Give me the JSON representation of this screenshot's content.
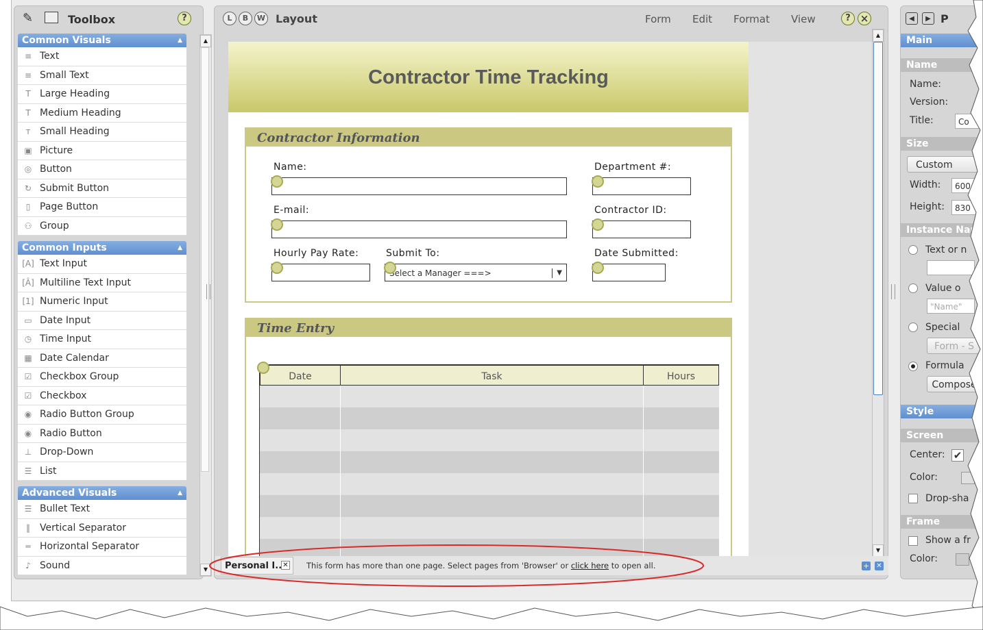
{
  "toolbox": {
    "title": "Toolbox",
    "help": "?",
    "categories": [
      {
        "label": "Common Visuals",
        "items": [
          "Text",
          "Small Text",
          "Large Heading",
          "Medium Heading",
          "Small Heading",
          "Picture",
          "Button",
          "Submit Button",
          "Page Button",
          "Group"
        ]
      },
      {
        "label": "Common Inputs",
        "items": [
          "Text Input",
          "Multiline Text Input",
          "Numeric Input",
          "Date Input",
          "Time Input",
          "Date Calendar",
          "Checkbox Group",
          "Checkbox",
          "Radio Button Group",
          "Radio Button",
          "Drop-Down",
          "List"
        ]
      },
      {
        "label": "Advanced Visuals",
        "items": [
          "Bullet Text",
          "Vertical Separator",
          "Horizontal Separator",
          "Sound"
        ]
      }
    ]
  },
  "layout": {
    "view_buttons": [
      "L",
      "B",
      "W"
    ],
    "title": "Layout",
    "menu": [
      "Form",
      "Edit",
      "Format",
      "View"
    ],
    "help": "?",
    "close": "×"
  },
  "form": {
    "title": "Contractor Time Tracking",
    "contractor_section": "Contractor Information",
    "labels": {
      "name": "Name:",
      "department": "Department #:",
      "email": "E-mail:",
      "contractor_id": "Contractor ID:",
      "hourly_rate": "Hourly Pay Rate:",
      "submit_to": "Submit To:",
      "date_submitted": "Date Submitted:"
    },
    "submit_to_value": "Select a Manager ===>",
    "time_section": "Time Entry",
    "table_headers": [
      "Date",
      "Task",
      "Hours"
    ]
  },
  "status_bar": {
    "page_tab": "Personal I...",
    "message_before": "This form has more than one page. Select pages from 'Browser' or ",
    "link": "click here",
    "message_after": " to open all."
  },
  "properties": {
    "title": "P",
    "main": "Main",
    "name_section": "Name",
    "name_label": "Name:",
    "version_label": "Version:",
    "title_label": "Title:",
    "title_value": "Co",
    "size_section": "Size",
    "size_button": "Custom",
    "width_label": "Width:",
    "width_value": "600",
    "height_label": "Height:",
    "height_value": "830",
    "instance_section": "Instance Nam",
    "opt_text": "Text or n",
    "opt_value": "Value o",
    "value_placeholder": "\"Name\"",
    "opt_special": "Special",
    "special_btn": "Form - S",
    "opt_formula": "Formula",
    "compose_btn": "Compose",
    "style": "Style",
    "screen_section": "Screen",
    "center_label": "Center:",
    "color_label": "Color:",
    "dropshadow_label": "Drop-sha",
    "frame_section": "Frame",
    "show_frame_label": "Show a fr",
    "frame_color_label": "Color:"
  }
}
